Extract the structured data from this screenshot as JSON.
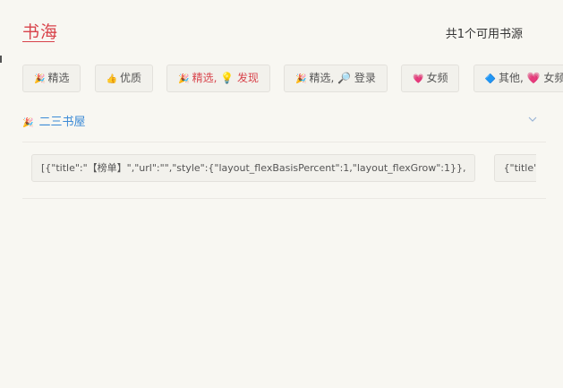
{
  "header": {
    "title": "书海",
    "source_count": "共1个可用书源"
  },
  "filters": [
    {
      "emoji": "🎉",
      "label": "精选"
    },
    {
      "emoji": "👍",
      "label": "优质"
    },
    {
      "emoji": "🎉",
      "label": "精选, 💡 发现"
    },
    {
      "emoji": "🎉",
      "label": "精选, 🔎 登录"
    },
    {
      "emoji": "💗",
      "label": "女频"
    },
    {
      "emoji": "🔷",
      "label": "其他, 💗 女频"
    }
  ],
  "active_filter": "精选, 💡 发现",
  "source": {
    "emoji": "🎉",
    "name": "二三书屋"
  },
  "source_tags": [
    "[{\"title\":\"【榜单】\",\"url\":\"\",\"style\":{\"layout_flexBasisPercent\":1,\"layout_flexGrow\":1}},",
    "{\"title\":\"周"
  ],
  "colors": {
    "accent": "#d8434b",
    "link": "#3d8bd6",
    "background": "#f8f7f2"
  }
}
